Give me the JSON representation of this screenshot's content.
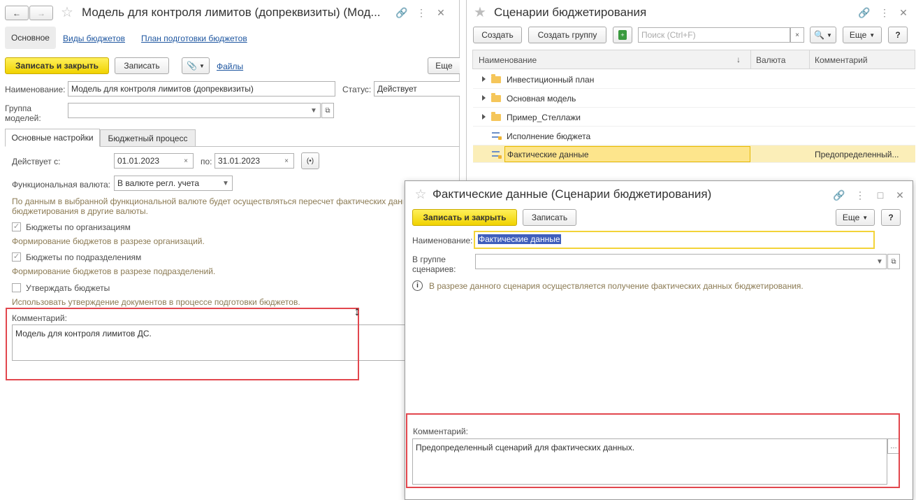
{
  "left_window": {
    "title": "Модель для контроля лимитов (допреквизиты) (Мод...",
    "nav": {
      "main": "Основное",
      "budget_types": "Виды бюджетов",
      "prep_plan": "План подготовки бюджетов"
    },
    "toolbar": {
      "save_close": "Записать и закрыть",
      "save": "Записать",
      "files": "Файлы",
      "more": "Еще"
    },
    "name_label": "Наименование:",
    "name_value": "Модель для контроля лимитов (допреквизиты)",
    "status_label": "Статус:",
    "status_value": "Действует",
    "group_label_1": "Группа",
    "group_label_2": "моделей:",
    "group_value": "",
    "tabs": {
      "basic": "Основные настройки",
      "process": "Бюджетный процесс"
    },
    "valid_from_label": "Действует с:",
    "valid_from": "01.01.2023",
    "valid_to_label": "по:",
    "valid_to": "31.01.2023",
    "func_currency_label": "Функциональная валюта:",
    "func_currency_value": "В валюте регл. учета",
    "currency_hint_1": "По данным в выбранной функциональной валюте будет осуществляться пересчет фактических данн",
    "currency_hint_2": "бюджетирования в другие валюты.",
    "by_org_label": "Бюджеты по организациям",
    "by_org_hint": "Формирование бюджетов в разрезе организаций.",
    "by_dept_label": "Бюджеты по подразделениям",
    "by_dept_hint": "Формирование бюджетов в разрезе подразделений.",
    "approve_label": "Утверждать бюджеты",
    "approve_hint": "Использовать утверждение документов в процессе подготовки бюджетов.",
    "comment_label": "Комментарий:",
    "comment_value": "Модель для контроля лимитов ДС."
  },
  "right_window": {
    "title": "Сценарии бюджетирования",
    "toolbar": {
      "create": "Создать",
      "create_group": "Создать группу",
      "search_placeholder": "Поиск (Ctrl+F)",
      "more": "Еще",
      "help": "?"
    },
    "columns": {
      "name": "Наименование",
      "currency": "Валюта",
      "comment": "Комментарий"
    },
    "rows": [
      {
        "name": "Инвестиционный план",
        "type": "folder",
        "comment": ""
      },
      {
        "name": "Основная модель",
        "type": "folder",
        "comment": ""
      },
      {
        "name": "Пример_Стеллажи",
        "type": "folder",
        "comment": ""
      },
      {
        "name": "Исполнение бюджета",
        "type": "item",
        "comment": ""
      },
      {
        "name": "Фактические данные",
        "type": "item",
        "comment": "Предопределенный..."
      }
    ]
  },
  "dialog": {
    "title": "Фактические данные (Сценарии бюджетирования)",
    "toolbar": {
      "save_close": "Записать и закрыть",
      "save": "Записать",
      "more": "Еще",
      "help": "?"
    },
    "name_label": "Наименование:",
    "name_value": "Фактические данные",
    "group_label_1": "В группе",
    "group_label_2": "сценариев:",
    "group_value": "",
    "info_text": "В разрезе данного сценария осуществляется получение фактических данных бюджетирования.",
    "comment_label": "Комментарий:",
    "comment_value": "Предопределенный сценарий для фактических данных."
  },
  "colors": {
    "accent_yellow": "#f3d339",
    "highlight_red": "#e2474e",
    "link_blue": "#1e56a0",
    "hint_brown": "#8b7a53"
  }
}
